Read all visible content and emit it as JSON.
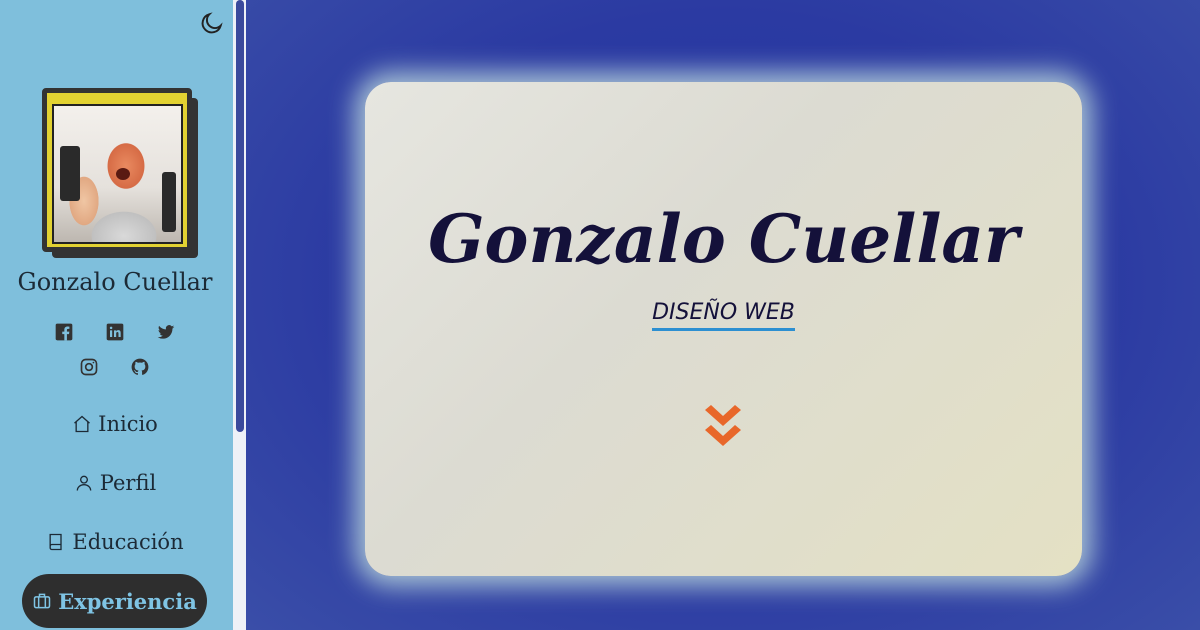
{
  "sidebar": {
    "name": "Gonzalo Cuellar",
    "social": [
      "facebook-icon",
      "linkedin-icon",
      "twitter-icon",
      "instagram-icon",
      "github-icon"
    ],
    "nav": [
      {
        "label": "Inicio",
        "icon": "home-icon"
      },
      {
        "label": "Perfil",
        "icon": "user-icon"
      },
      {
        "label": "Educación",
        "icon": "book-icon"
      },
      {
        "label": "Experiencia",
        "icon": "briefcase-icon",
        "active": true
      }
    ]
  },
  "hero": {
    "title": "Gonzalo Cuellar",
    "subtitle": "DISEÑO WEB"
  },
  "colors": {
    "sidebar_bg": "#7fbfdc",
    "main_bg": "#2b3aa2",
    "accent_orange": "#e8672a",
    "underline_blue": "#2c8fd1",
    "active_nav_bg": "#2e2e2e"
  }
}
